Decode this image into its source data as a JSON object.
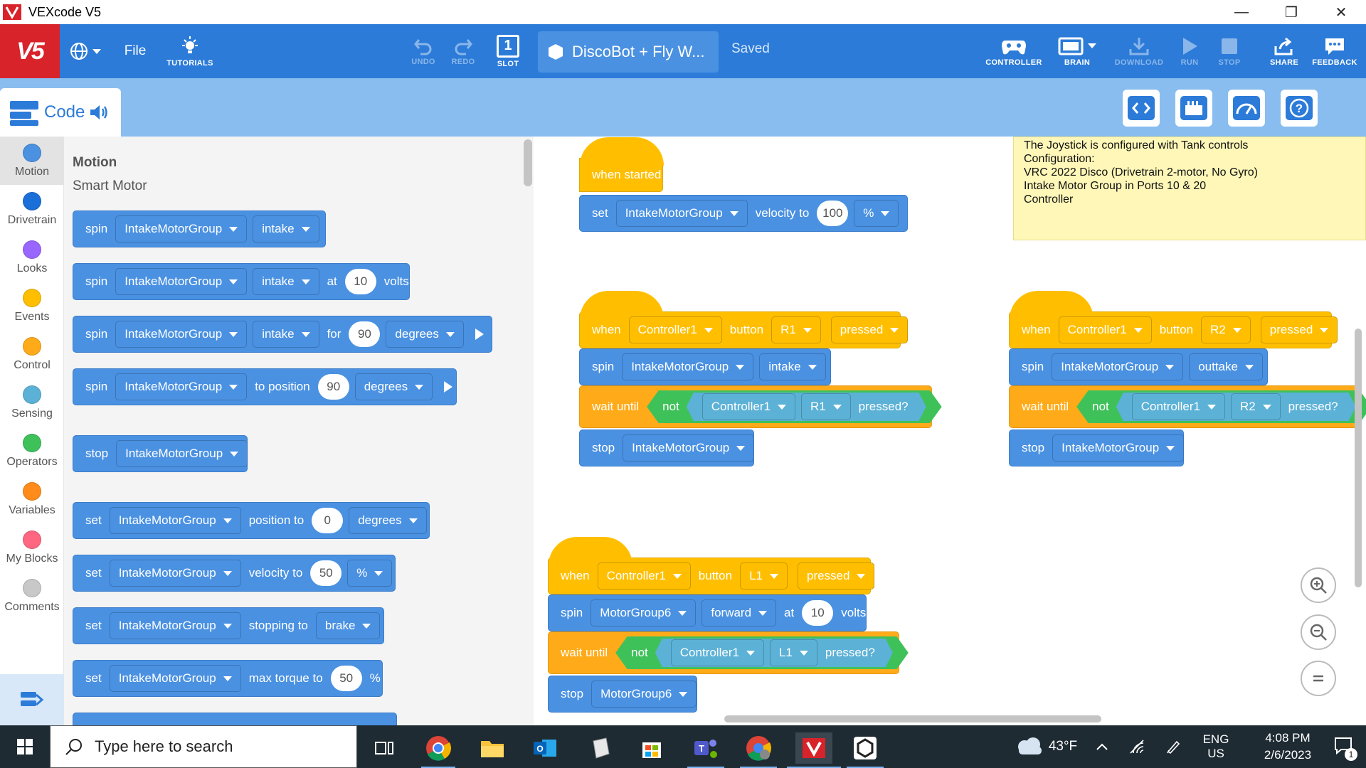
{
  "window": {
    "title": "VEXcode V5",
    "controls": [
      "—",
      "❐",
      "✕"
    ]
  },
  "topbar": {
    "logo": "V5",
    "file_label": "File",
    "tutorials_label": "TUTORIALS",
    "undo_label": "UNDO",
    "redo_label": "REDO",
    "slot_label": "SLOT",
    "slot_number": "1",
    "project_name": "DiscoBot + Fly W...",
    "status": "Saved",
    "controller_label": "CONTROLLER",
    "brain_label": "BRAIN",
    "download_label": "DOWNLOAD",
    "run_label": "RUN",
    "stop_label": "STOP",
    "share_label": "SHARE",
    "feedback_label": "FEEDBACK"
  },
  "subbar": {
    "code_tab": "Code"
  },
  "categories": [
    {
      "label": "Motion",
      "color": "#4a91e2"
    },
    {
      "label": "Drivetrain",
      "color": "#1a6fd8"
    },
    {
      "label": "Looks",
      "color": "#9966ff"
    },
    {
      "label": "Events",
      "color": "#ffbf00"
    },
    {
      "label": "Control",
      "color": "#ffab19"
    },
    {
      "label": "Sensing",
      "color": "#5cb1d6"
    },
    {
      "label": "Operators",
      "color": "#3fc15a"
    },
    {
      "label": "Variables",
      "color": "#ff8c1a"
    },
    {
      "label": "My Blocks",
      "color": "#ff6680"
    },
    {
      "label": "Comments",
      "color": "#c8c8c8"
    }
  ],
  "palette": {
    "heading": "Motion",
    "subheading": "Smart Motor",
    "blocks": {
      "b1": {
        "w1": "spin",
        "dd1": "IntakeMotorGroup",
        "dd2": "intake"
      },
      "b2": {
        "w1": "spin",
        "dd1": "IntakeMotorGroup",
        "dd2": "intake",
        "w2": "at",
        "n1": "10",
        "w3": "volts"
      },
      "b3": {
        "w1": "spin",
        "dd1": "IntakeMotorGroup",
        "dd2": "intake",
        "w2": "for",
        "n1": "90",
        "dd3": "degrees"
      },
      "b4": {
        "w1": "spin",
        "dd1": "IntakeMotorGroup",
        "w2": "to position",
        "n1": "90",
        "dd3": "degrees"
      },
      "b5": {
        "w1": "stop",
        "dd1": "IntakeMotorGroup"
      },
      "b6": {
        "w1": "set",
        "dd1": "IntakeMotorGroup",
        "w2": "position to",
        "n1": "0",
        "dd3": "degrees"
      },
      "b7": {
        "w1": "set",
        "dd1": "IntakeMotorGroup",
        "w2": "velocity to",
        "n1": "50",
        "dd3": "%"
      },
      "b8": {
        "w1": "set",
        "dd1": "IntakeMotorGroup",
        "w2": "stopping to",
        "dd3": "brake"
      },
      "b9": {
        "w1": "set",
        "dd1": "IntakeMotorGroup",
        "w2": "max torque to",
        "n1": "50",
        "w3": "%"
      }
    }
  },
  "workspace": {
    "g1": {
      "hat": "when started",
      "set": "set",
      "set_dd": "IntakeMotorGroup",
      "set_mid": "velocity to",
      "set_num": "100",
      "set_unit": "%"
    },
    "g2": {
      "when": "when",
      "ctrl": "Controller1",
      "button": "button",
      "btn": "R1",
      "event": "pressed",
      "spin": "spin",
      "spin_dd": "IntakeMotorGroup",
      "spin_dir": "intake",
      "wait": "wait until",
      "not": "not",
      "cond_ctrl": "Controller1",
      "cond_btn": "R1",
      "cond_q": "pressed?",
      "stop": "stop",
      "stop_dd": "IntakeMotorGroup"
    },
    "g3": {
      "when": "when",
      "ctrl": "Controller1",
      "button": "button",
      "btn": "R2",
      "event": "pressed",
      "spin": "spin",
      "spin_dd": "IntakeMotorGroup",
      "spin_dir": "outtake",
      "wait": "wait until",
      "not": "not",
      "cond_ctrl": "Controller1",
      "cond_btn": "R2",
      "cond_q": "pressed?",
      "stop": "stop",
      "stop_dd": "IntakeMotorGroup"
    },
    "g4": {
      "when": "when",
      "ctrl": "Controller1",
      "button": "button",
      "btn": "L1",
      "event": "pressed",
      "spin": "spin",
      "spin_dd": "MotorGroup6",
      "spin_dir": "forward",
      "at": "at",
      "volts_num": "10",
      "volts": "volts",
      "wait": "wait until",
      "not": "not",
      "cond_ctrl": "Controller1",
      "cond_btn": "L1",
      "cond_q": "pressed?",
      "stop": "stop",
      "stop_dd": "MotorGroup6"
    },
    "note": {
      "line1": "The Joystick is configured with Tank controls",
      "line2": "",
      "line3": "Configuration:",
      "line4": "VRC 2022 Disco (Drivetrain 2-motor, No Gyro)",
      "line5": "Intake Motor Group in Ports 10 & 20",
      "line6": "Controller"
    }
  },
  "taskbar": {
    "search_placeholder": "Type here to search",
    "weather_temp": "43°F",
    "language_top": "ENG",
    "language_bottom": "US",
    "time": "4:08 PM",
    "date": "2/6/2023",
    "notification_count": "1"
  }
}
